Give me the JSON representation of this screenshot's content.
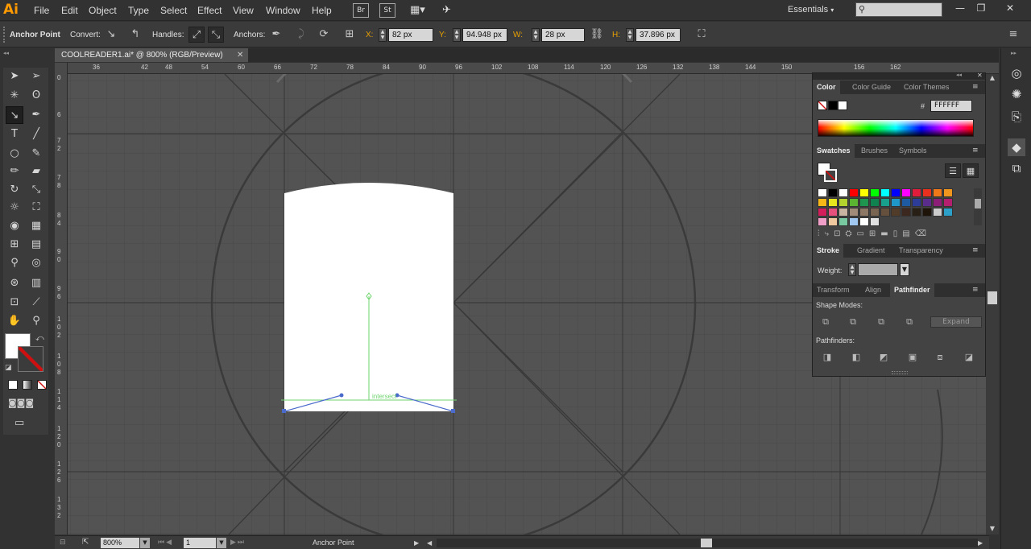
{
  "app": {
    "logo": "Ai"
  },
  "menu": [
    "File",
    "Edit",
    "Object",
    "Type",
    "Select",
    "Effect",
    "View",
    "Window",
    "Help"
  ],
  "bridge": {
    "br": "Br",
    "st": "St"
  },
  "workspace": {
    "label": "Essentials"
  },
  "window_controls": {
    "minimize": "—",
    "restore": "❐",
    "close": "✕"
  },
  "control": {
    "tool_name": "Anchor Point",
    "convert_label": "Convert:",
    "handles_label": "Handles:",
    "anchors_label": "Anchors:",
    "x_label": "X:",
    "x_value": "82 px",
    "y_label": "Y:",
    "y_value": "94.948 px",
    "w_label": "W:",
    "w_value": "28 px",
    "h_label": "H:",
    "h_value": "37.896 px"
  },
  "document": {
    "tab_title": "COOLREADER1.ai* @ 800% (RGB/Preview)",
    "close": "✕"
  },
  "ruler_top": [
    "36",
    "42",
    "48",
    "54",
    "60",
    "66",
    "72",
    "78",
    "84",
    "90",
    "96",
    "102",
    "108",
    "114",
    "120",
    "126",
    "132",
    "138",
    "144",
    "150",
    "156",
    "162"
  ],
  "ruler_left": [
    "0",
    "6",
    "7",
    "2",
    "7",
    "8",
    "8",
    "4",
    "9",
    "0",
    "9",
    "6",
    "1",
    "0",
    "2",
    "1",
    "0",
    "8",
    "1",
    "1",
    "4",
    "1",
    "2",
    "0",
    "1",
    "2",
    "6",
    "1",
    "3",
    "2"
  ],
  "canvas": {
    "smart_guide": "intersect"
  },
  "panels": {
    "color_tabs": [
      "Color",
      "Color Guide",
      "Color Themes"
    ],
    "hex_label": "#",
    "hex_value": "FFFFFF",
    "swatch_tabs": [
      "Swatches",
      "Brushes",
      "Symbols"
    ],
    "stroke_tabs": [
      "Stroke",
      "Gradient",
      "Transparency"
    ],
    "weight_label": "Weight:",
    "path_tabs": [
      "Transform",
      "Align",
      "Pathfinder"
    ],
    "shape_modes_label": "Shape Modes:",
    "expand_label": "Expand",
    "pathfinders_label": "Pathfinders:",
    "swatch_colors": [
      "#ffffff",
      "#000000",
      "#ffffff",
      "#ff0000",
      "#ffff00",
      "#00ff00",
      "#00ffff",
      "#0000ff",
      "#ff00ff",
      "#e01e3c",
      "#e8301e",
      "#f07818",
      "#f0961e",
      "#f7b817",
      "#e6e61e",
      "#b4d22d",
      "#5ab432",
      "#1e9650",
      "#0f8250",
      "#18a08c",
      "#1e96c8",
      "#1e5aa0",
      "#2d3c96",
      "#5a2d8c",
      "#8c1e78",
      "#b41e6e",
      "#d21e5a",
      "#e6507d",
      "#c8b4a0",
      "#a08c78",
      "#8c7864",
      "#786450",
      "#64503c",
      "#503c28",
      "#3c281e",
      "#282014",
      "#1e140a",
      "#cccccc",
      "#2ca0c8",
      "#f0a0c8",
      "#f0c8a0",
      "#78c8a0",
      "#a0c8f0",
      "#ffffff",
      "#e0e0e0"
    ]
  },
  "status": {
    "zoom": "800%",
    "artboard": "1",
    "tool": "Anchor Point"
  }
}
